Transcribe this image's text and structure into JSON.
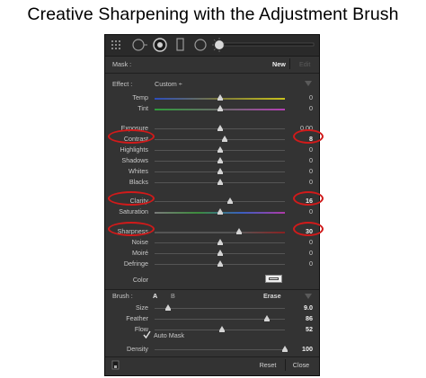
{
  "title": "Creative Sharpening with the Adjustment Brush",
  "mask": {
    "label": "Mask :",
    "new": "New",
    "edit": "Edit"
  },
  "effect": {
    "label": "Effect :",
    "value": "Custom ÷"
  },
  "sliders": [
    {
      "id": "temp",
      "label": "Temp",
      "value": "0",
      "level": 0.5
    },
    {
      "id": "tint",
      "label": "Tint",
      "value": "0",
      "level": 0.5
    },
    {
      "id": "exposure",
      "label": "Exposure",
      "value": "0.00",
      "level": 0.5
    },
    {
      "id": "contrast",
      "label": "Contrast",
      "value": "8",
      "level": 0.54
    },
    {
      "id": "highlights",
      "label": "Highlights",
      "value": "0",
      "level": 0.5
    },
    {
      "id": "shadows",
      "label": "Shadows",
      "value": "0",
      "level": 0.5
    },
    {
      "id": "whites",
      "label": "Whites",
      "value": "0",
      "level": 0.5
    },
    {
      "id": "blacks",
      "label": "Blacks",
      "value": "0",
      "level": 0.5
    },
    {
      "id": "clarity",
      "label": "Clarity",
      "value": "16",
      "level": 0.58
    },
    {
      "id": "saturation",
      "label": "Saturation",
      "value": "0",
      "level": 0.5
    },
    {
      "id": "sharpness",
      "label": "Sharpness",
      "value": "30",
      "level": 0.65
    },
    {
      "id": "noise",
      "label": "Noise",
      "value": "0",
      "level": 0.5
    },
    {
      "id": "moire",
      "label": "Moiré",
      "value": "0",
      "level": 0.5
    },
    {
      "id": "defringe",
      "label": "Defringe",
      "value": "0",
      "level": 0.5
    }
  ],
  "color": {
    "label": "Color"
  },
  "brush": {
    "label": "Brush :",
    "a": "A",
    "b": "B",
    "erase": "Erase"
  },
  "brush_sliders": [
    {
      "id": "size",
      "label": "Size",
      "value": "9.0",
      "level": 0.1
    },
    {
      "id": "feather",
      "label": "Feather",
      "value": "86",
      "level": 0.86
    },
    {
      "id": "flow",
      "label": "Flow",
      "value": "52",
      "level": 0.52
    },
    {
      "id": "density",
      "label": "Density",
      "value": "100",
      "level": 1.0
    }
  ],
  "auto_mask": {
    "label": "Auto Mask",
    "checked": true
  },
  "footer": {
    "reset": "Reset",
    "close": "Close"
  },
  "colors": {
    "highlight": "#d11a1a",
    "panel": "#333333"
  }
}
